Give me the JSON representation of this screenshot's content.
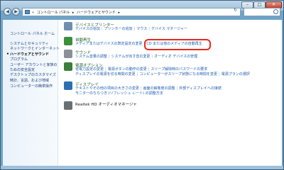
{
  "window": {
    "controls": {
      "minimize": "–",
      "maximize": "□",
      "close": "✕"
    }
  },
  "nav": {
    "back": "◀",
    "forward": "▶",
    "refresh": "↻"
  },
  "address": {
    "breadcrumbs": [
      "«",
      "コントロール パネル",
      "▸",
      "ハードウェアとサウンド",
      "▸"
    ]
  },
  "sidebar": {
    "items": [
      {
        "label": "コントロール パネル ホーム"
      },
      {
        "label": "システムとセキュリティ"
      },
      {
        "label": "ネットワークとインターネット"
      },
      {
        "label": "ハードウェアとサウンド"
      },
      {
        "label": "プログラム"
      },
      {
        "label": "ユーザー アカウントと家族の"
      },
      {
        "label": "ための安全設定"
      },
      {
        "label": "デスクトップのカスタマイズ"
      },
      {
        "label": "時計、言語、および地域"
      },
      {
        "label": "コンピューターの簡単操作"
      }
    ]
  },
  "categories": [
    {
      "title": "デバイスとプリンター",
      "links": [
        "デバイスの追加",
        "プリンターの追加",
        "マウス",
        "デバイス マネージャー"
      ],
      "color": "#6f8fb0"
    },
    {
      "title": "自動再生",
      "links": [
        "メディアまたはデバイスの既定設定の変更",
        "CD または他のメディアの自動再生"
      ],
      "color": "#3d8f3d"
    },
    {
      "title": "サウンド",
      "links": [
        "システム音量の調整",
        "システムが出す音の変更",
        "オーディオ デバイスの管理"
      ],
      "color": "#8a8f99"
    },
    {
      "title": "電源オプション",
      "links_line1": [
        "省電力設定の変更",
        "電源ボタンの動作の変更",
        "スリープ解除時のパスワードの要求"
      ],
      "links_line2": [
        "ディスプレイの電源を切る時間の変更",
        "コンピューターがスリープ状態になる時間を変更",
        "電源プランの選択"
      ],
      "color": "#3a7f3a"
    },
    {
      "title": "ディスプレイ",
      "links_line1": [
        "テキストやその他の項目の大きさの変更",
        "画面の解像度の調整",
        "外部ディスプレイへの接続"
      ],
      "links_line2": [
        "モニターのちらつき (リフレッシュ レート) の調整方法"
      ],
      "color": "#2d6fb3"
    },
    {
      "title": "Realtek HD オーディオマネージャ",
      "color": "#6a6f73"
    }
  ]
}
